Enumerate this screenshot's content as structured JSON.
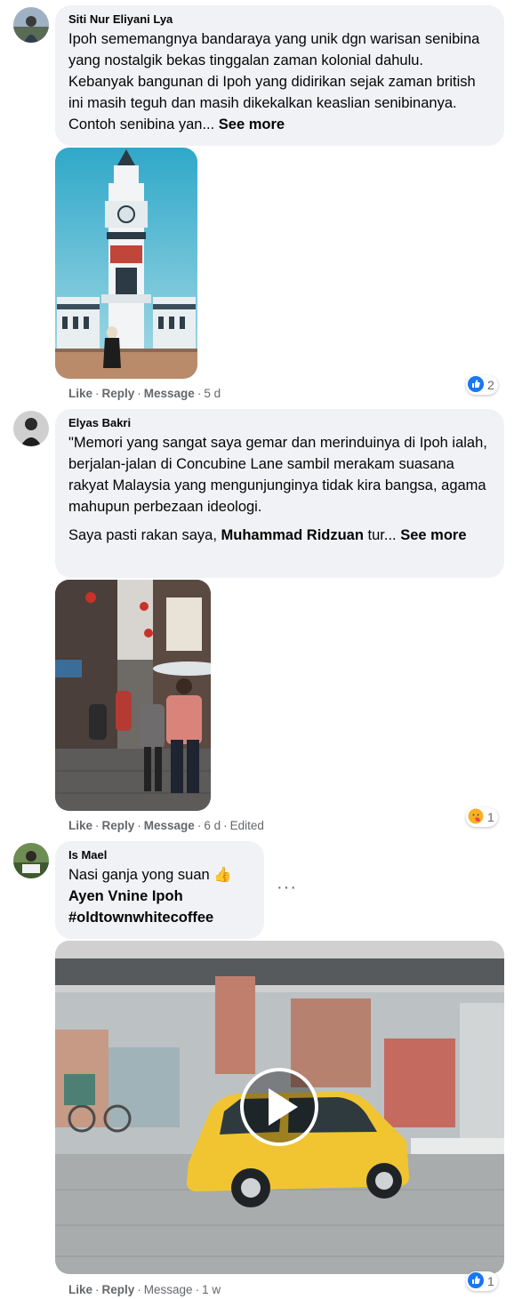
{
  "comments": [
    {
      "author": "Siti Nur Eliyani Lya",
      "text": "Ipoh sememangnya bandaraya yang unik dgn warisan senibina yang nostalgik bekas tinggalan zaman kolonial dahulu. Kebanyak bangunan di Ipoh yang didirikan sejak zaman british ini masih teguh dan masih dikekalkan keaslian senibinanya. Contoh senibina yan...",
      "see_more": "See more",
      "actions": {
        "like": "Like",
        "reply": "Reply",
        "message": "Message",
        "time": "5 d",
        "edited": ""
      },
      "reaction": {
        "type": "like",
        "count": "2"
      }
    },
    {
      "author": "Elyas Bakri",
      "paragraph1": "\"Memori yang sangat saya gemar dan merinduinya di Ipoh ialah, berjalan-jalan di Concubine Lane sambil merakam suasana rakyat Malaysia yang mengunjunginya tidak kira bangsa, agama mahupun perbezaan ideologi.",
      "paragraph2_start": "Saya pasti rakan saya, ",
      "mention": "Muhammad Ridzuan",
      "paragraph2_end": " tur...",
      "see_more": "See more",
      "actions": {
        "like": "Like",
        "reply": "Reply",
        "message": "Message",
        "time": "6 d",
        "edited": "Edited"
      },
      "reaction": {
        "type": "care",
        "count": "1"
      }
    },
    {
      "author": "Is Mael",
      "line1": "Nasi ganja yong suan",
      "emoji": "👍",
      "mention": "Ayen Vnine Ipoh",
      "hashtag": "#oldtownwhitecoffee",
      "more_menu": "···",
      "actions": {
        "like": "Like",
        "reply": "Reply",
        "message": "Message",
        "time": "1 w",
        "edited": ""
      },
      "reaction": {
        "type": "like",
        "count": "1"
      }
    }
  ],
  "colors": {
    "like_blue": "#1877f2",
    "bubble_bg": "#f0f2f5",
    "meta_gray": "#65676b"
  }
}
